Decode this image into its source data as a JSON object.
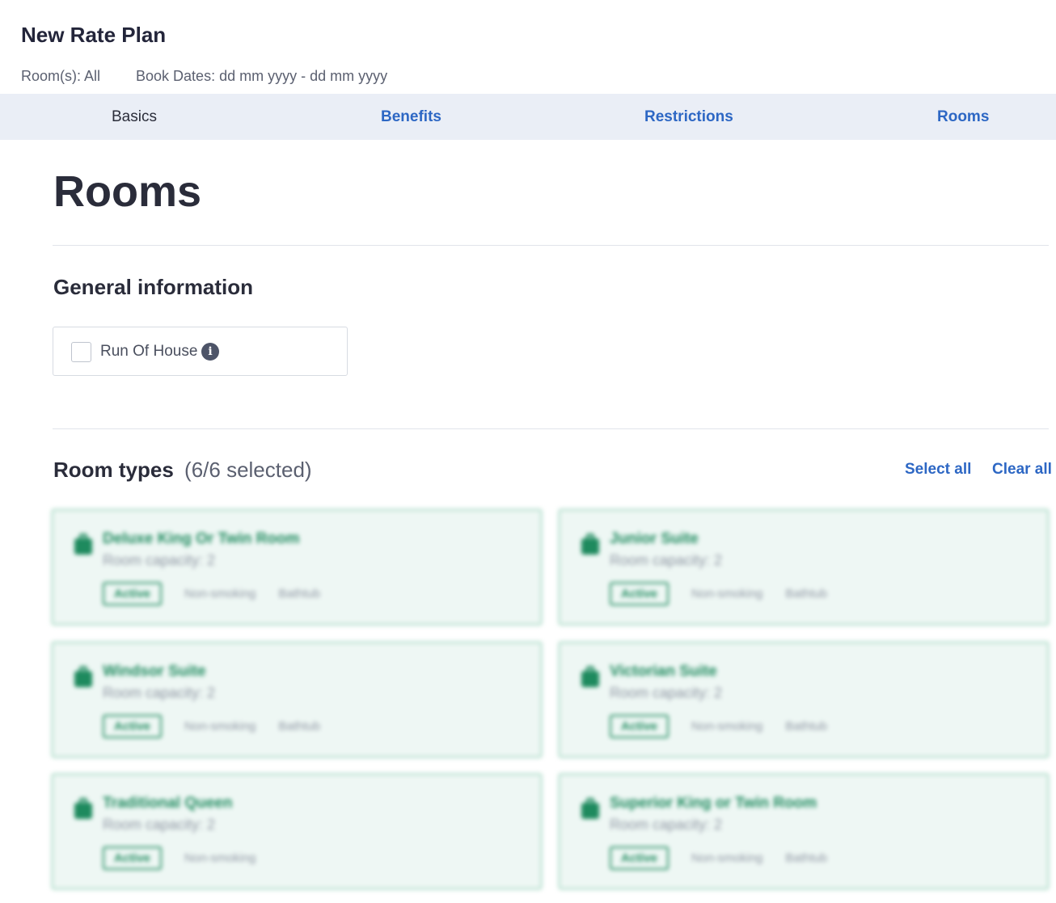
{
  "header": {
    "title": "New Rate Plan",
    "rooms_meta": "Room(s): All",
    "book_dates_meta": "Book Dates: dd mm yyyy - dd mm yyyy"
  },
  "tabs": [
    {
      "label": "Basics",
      "active": true
    },
    {
      "label": "Benefits",
      "active": false
    },
    {
      "label": "Restrictions",
      "active": false
    },
    {
      "label": "Rooms",
      "active": false
    }
  ],
  "page": {
    "title": "Rooms"
  },
  "general_information": {
    "title": "General information",
    "run_of_house": {
      "label": "Run Of House",
      "checked": false
    }
  },
  "room_types": {
    "title": "Room types",
    "count_label": "(6/6 selected)",
    "select_all_label": "Select all",
    "clear_all_label": "Clear all",
    "items": [
      {
        "name": "Deluxe King Or Twin Room",
        "capacity": "Room capacity: 2",
        "status": "Active",
        "tags": [
          "Non-smoking",
          "Bathtub"
        ]
      },
      {
        "name": "Junior Suite",
        "capacity": "Room capacity: 2",
        "status": "Active",
        "tags": [
          "Non-smoking",
          "Bathtub"
        ]
      },
      {
        "name": "Windsor Suite",
        "capacity": "Room capacity: 2",
        "status": "Active",
        "tags": [
          "Non-smoking",
          "Bathtub"
        ]
      },
      {
        "name": "Victorian Suite",
        "capacity": "Room capacity: 2",
        "status": "Active",
        "tags": [
          "Non-smoking",
          "Bathtub"
        ]
      },
      {
        "name": "Traditional Queen",
        "capacity": "Room capacity: 2",
        "status": "Active",
        "tags": [
          "Non-smoking"
        ]
      },
      {
        "name": "Superior King or Twin Room",
        "capacity": "Room capacity: 2",
        "status": "Active",
        "tags": [
          "Non-smoking",
          "Bathtub"
        ]
      }
    ]
  },
  "colors": {
    "accent": "#2d67c4",
    "tab_bar": "#eaeef6",
    "room_green": "#1e8a5e",
    "card_bg": "#eef7f4",
    "card_border": "#bfe3d4"
  },
  "icons": {
    "info": "info-icon",
    "room": "suitcase-icon"
  }
}
